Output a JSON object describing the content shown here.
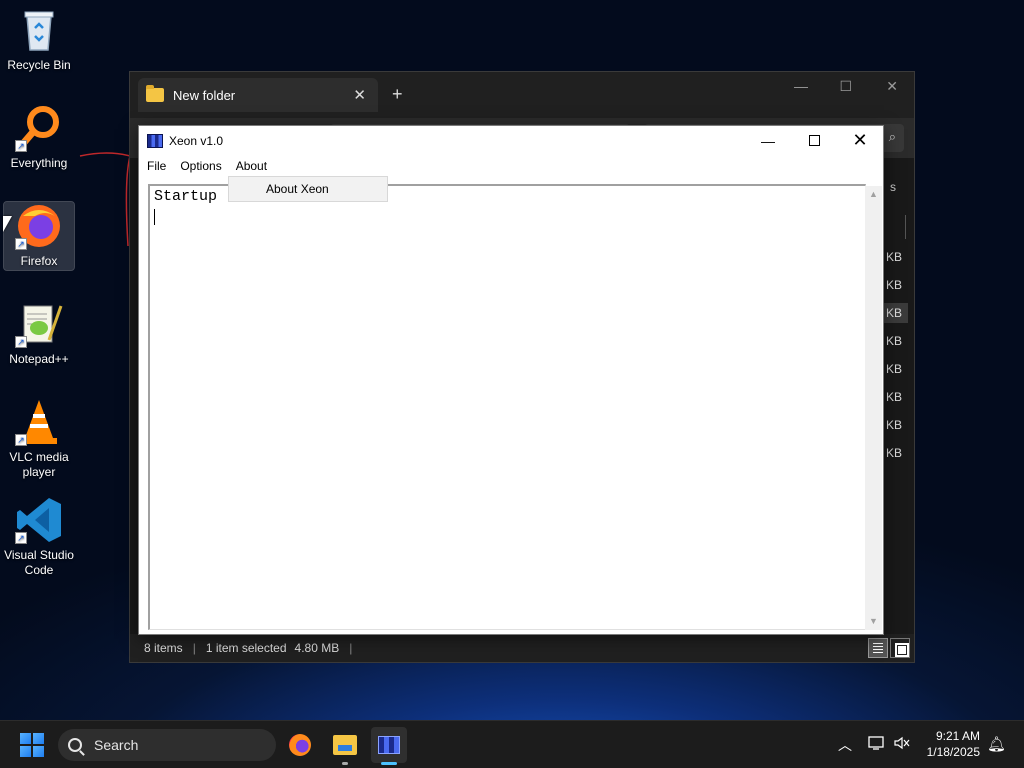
{
  "desktop": {
    "icons": [
      {
        "label": "Recycle Bin",
        "icon": "recycle-bin-icon"
      },
      {
        "label": "Everything",
        "icon": "everything-search-icon"
      },
      {
        "label": "Firefox",
        "icon": "firefox-icon"
      },
      {
        "label": "Notepad++",
        "icon": "notepad-plus-plus-icon"
      },
      {
        "label": "VLC media player",
        "icon": "vlc-icon"
      },
      {
        "label": "Visual Studio Code",
        "icon": "vscode-icon"
      }
    ]
  },
  "explorer": {
    "tab_title": "New folder",
    "tab_close": "✕",
    "new_tab": "+",
    "column_partial": "s",
    "sizes": [
      "KB",
      "KB",
      "KB",
      "KB",
      "KB",
      "KB",
      "KB",
      "KB"
    ],
    "selected_row_index": 2,
    "status": {
      "items": "8 items",
      "selected": "1 item selected",
      "size": "4.80 MB"
    }
  },
  "xeon": {
    "title": "Xeon v1.0",
    "menu": {
      "file": "File",
      "options": "Options",
      "about": "About"
    },
    "about_menu_item": "About Xeon",
    "editor_text": "Startup"
  },
  "taskbar": {
    "search_placeholder": "Search",
    "time": "9:21 AM",
    "date": "1/18/2025",
    "apps": [
      "firefox-icon",
      "file-explorer-icon",
      "xeon-icon"
    ],
    "active_app": "xeon-icon"
  },
  "colors": {
    "accent": "#4cc2ff",
    "taskbar": "#1c1c1c",
    "explorer_bg": "#1f1f1f"
  }
}
